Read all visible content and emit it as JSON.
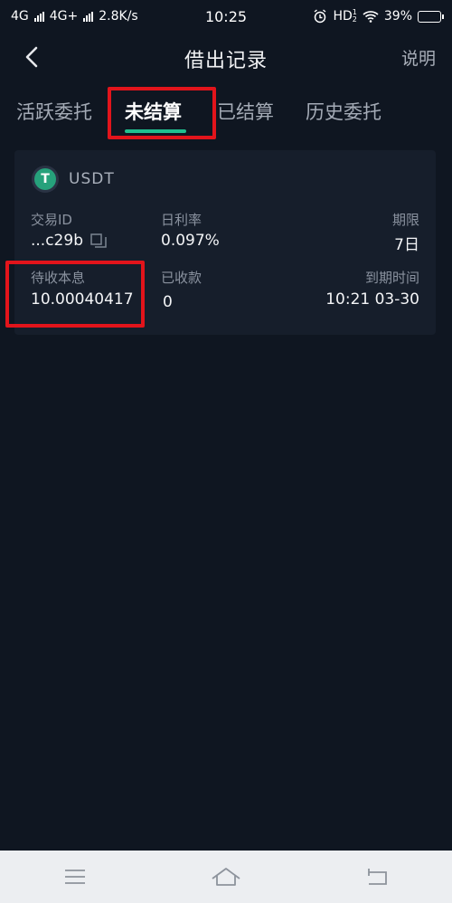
{
  "status_bar": {
    "network1": "4G",
    "network2": "4G+",
    "speed": "2.8K/s",
    "time": "10:25",
    "hd": "HD",
    "hd_sup": "1",
    "hd_sub": "2",
    "battery_percent": "39%",
    "battery_level": 0.39
  },
  "header": {
    "title": "借出记录",
    "help_label": "说明",
    "back_icon": "chevron-left-icon"
  },
  "tabs": [
    {
      "label": "活跃委托",
      "active": false
    },
    {
      "label": "未结算",
      "active": true
    },
    {
      "label": "已结算",
      "active": false
    },
    {
      "label": "历史委托",
      "active": false
    }
  ],
  "record": {
    "coin": "USDT",
    "coin_icon_letter": "T",
    "trade_id_label": "交易ID",
    "trade_id_value": "...c29b",
    "daily_rate_label": "日利率",
    "daily_rate_value": "0.097%",
    "term_label": "期限",
    "term_value": "7日",
    "pending_label": "待收本息",
    "pending_value": "10.00040417",
    "received_label": "已收款",
    "received_value": "0",
    "due_label": "到期时间",
    "due_value": "10:21 03-30"
  },
  "colors": {
    "background": "#0f1621",
    "card": "#161e2b",
    "accent": "#1fbf8f",
    "highlight": "#e2141b",
    "usdt": "#26a17b"
  },
  "navbar": {
    "menu_icon": "menu-icon",
    "home_icon": "home-icon",
    "back_icon": "back-icon"
  }
}
